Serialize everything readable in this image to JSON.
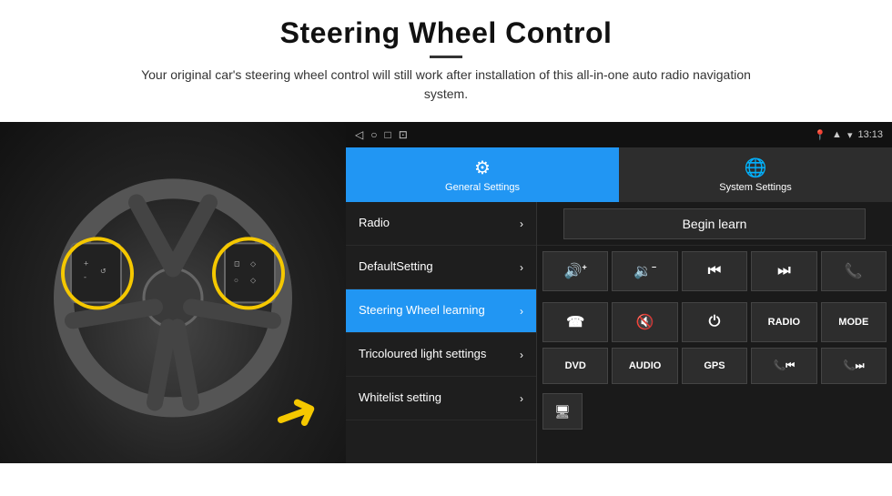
{
  "header": {
    "title": "Steering Wheel Control",
    "subtitle": "Your original car's steering wheel control will still work after installation of this all-in-one auto radio navigation system."
  },
  "status_bar": {
    "time": "13:13",
    "icons": [
      "◁",
      "○",
      "□",
      "⊡"
    ]
  },
  "tabs": [
    {
      "id": "general",
      "label": "General Settings",
      "active": true
    },
    {
      "id": "system",
      "label": "System Settings",
      "active": false
    }
  ],
  "menu_items": [
    {
      "id": "radio",
      "label": "Radio",
      "active": false
    },
    {
      "id": "default",
      "label": "DefaultSetting",
      "active": false
    },
    {
      "id": "steering",
      "label": "Steering Wheel learning",
      "active": true
    },
    {
      "id": "tricoloured",
      "label": "Tricoloured light settings",
      "active": false
    },
    {
      "id": "whitelist",
      "label": "Whitelist setting",
      "active": false
    }
  ],
  "begin_learn": "Begin learn",
  "control_buttons_row1": [
    {
      "id": "vol_up",
      "icon": "🔊+",
      "label": ""
    },
    {
      "id": "vol_down",
      "icon": "🔉-",
      "label": ""
    },
    {
      "id": "prev_track",
      "icon": "⏮",
      "label": ""
    },
    {
      "id": "next_track",
      "icon": "⏭",
      "label": ""
    },
    {
      "id": "phone",
      "icon": "📞",
      "label": ""
    }
  ],
  "control_buttons_row2": [
    {
      "id": "hang_up",
      "icon": "📵",
      "label": ""
    },
    {
      "id": "mute",
      "icon": "🔇",
      "label": ""
    },
    {
      "id": "power",
      "icon": "⏻",
      "label": ""
    },
    {
      "id": "radio_btn",
      "icon": "RADIO",
      "label": ""
    },
    {
      "id": "mode",
      "icon": "MODE",
      "label": ""
    }
  ],
  "control_buttons_row3": [
    {
      "id": "dvd",
      "label": "DVD"
    },
    {
      "id": "audio",
      "label": "AUDIO"
    },
    {
      "id": "gps",
      "label": "GPS"
    },
    {
      "id": "tel_prev",
      "label": "📞⏮"
    },
    {
      "id": "tel_next",
      "label": "📞⏭"
    }
  ],
  "bottom_icon_btn": "🖥"
}
